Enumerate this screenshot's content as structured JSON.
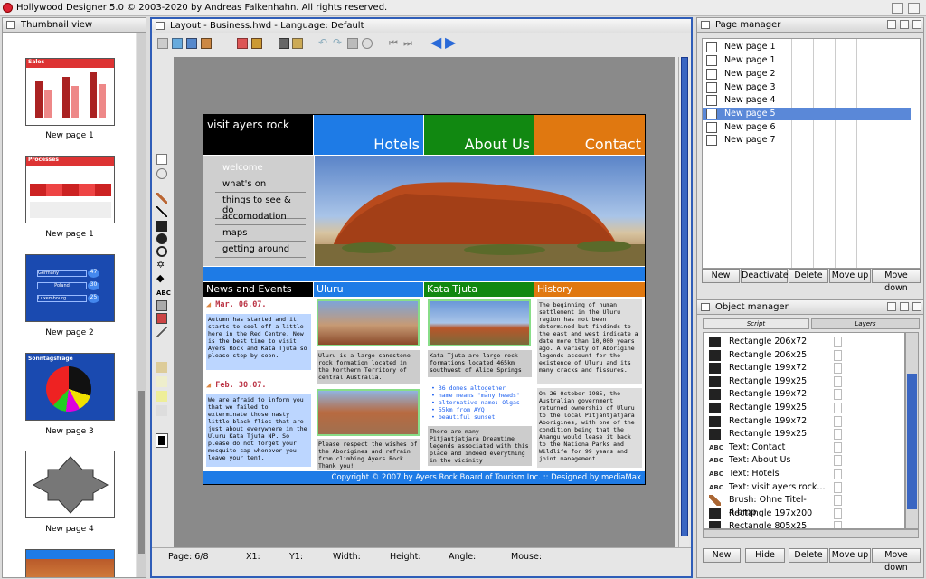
{
  "app": {
    "title": "Hollywood Designer 5.0 © 2003-2020 by Andreas Falkenhahn. All rights reserved."
  },
  "thumbnail_panel": {
    "title": "Thumbnail view",
    "thumbs": [
      {
        "label": "New page 1",
        "kind": "Sales"
      },
      {
        "label": "New page 1",
        "kind": "Processes"
      },
      {
        "label": "New page 2",
        "kind": "Countries",
        "rows": [
          {
            "name": "Germany",
            "value": "47"
          },
          {
            "name": "Poland",
            "value": "30"
          },
          {
            "name": "Luxembourg",
            "value": "25"
          }
        ]
      },
      {
        "label": "New page 3",
        "kind": "Sonntagsfrage"
      },
      {
        "label": "New page 4",
        "kind": "Shape"
      },
      {
        "label": "",
        "kind": "Ayers"
      }
    ],
    "thumb_titles": {
      "sales": "Sales",
      "processes": "Processes",
      "sonntag": "Sonntagsfrage"
    }
  },
  "layout": {
    "title": "Layout - Business.hwd - Language: Default"
  },
  "statusbar": {
    "page": "Page:  6/8",
    "x1": "X1:",
    "y1": "Y1:",
    "width": "Width:",
    "height": "Height:",
    "angle": "Angle:",
    "mouse": "Mouse:"
  },
  "site": {
    "brand": "visit ayers rock",
    "nav": [
      {
        "label": "Hotels",
        "color": "#1e7be6"
      },
      {
        "label": "About Us",
        "color": "#118811"
      },
      {
        "label": "Contact",
        "color": "#e07810"
      }
    ],
    "menu": [
      "welcome",
      "what's on",
      "things to see & do",
      "accomodation",
      "maps",
      "getting around"
    ],
    "sections": {
      "news": "News and Events",
      "uluru": "Uluru",
      "kata": "Kata Tjuta",
      "history": "History"
    },
    "news": [
      {
        "date": "Mar. 06.07.",
        "text": "Autumn has started and it starts to cool off a little here in the Red Centre. Now is the best time to visit Ayers Rock and Kata Tjuta so please stop by soon."
      },
      {
        "date": "Feb. 30.07.",
        "text": "We are afraid to inform you that we failed to exterminate those nasty little black flies that are just about everywhere in the Uluru Kata Tjuta NP. So please do not forget your mosquito cap whenever you leave your tent."
      }
    ],
    "uluru_text1": "Uluru is a large sandstone rock formation located in the Northern Territory of central Australia.",
    "uluru_text2": "Please respect the wishes of the Aborigines and refrain from climbing Ayers Rock. Thank you!",
    "kata_text1": "Kata Tjuta are large rock formations located 465km southwest of Alice Springs",
    "kata_bullets": [
      "36 domes altogether",
      "name means \"many heads\"",
      "alternative name: Olgas",
      "55km from AYQ",
      "beautiful sunset"
    ],
    "kata_text2": "There are many Pitjantjatjara Dreamtime legends associated with this place and indeed everything in the vicinity",
    "history1": "The beginning of human settlement in the Uluru region has not been determined but findinds to the east and west indicate a date more than 10,000 years ago. A variety of Aborigine legends account for the existence of Uluru and its many cracks and fissures.",
    "history2": "On 26 October 1985, the Australian government returned ownership of Uluru to the local Pitjantjatjara Aborigines, with one of the condition being that the Anangu would lease it back to the Nationa Parks and Wildlife for 99 years and joint management.",
    "footer": "Copyright © 2007 by Ayers Rock Board of Tourism Inc. :: Designed by mediaMax"
  },
  "page_manager": {
    "title": "Page manager",
    "pages": [
      "New page 1",
      "New page 1",
      "New page 2",
      "New page 3",
      "New page 4",
      "New page 5",
      "New page 6",
      "New page 7"
    ],
    "selected_index": 5,
    "buttons": [
      "New",
      "Deactivate",
      "Delete",
      "Move up",
      "Move down"
    ]
  },
  "object_manager": {
    "title": "Object manager",
    "tabs": [
      "Script",
      "Layers"
    ],
    "objects": [
      {
        "name": "Rectangle 206x72",
        "type": "rect"
      },
      {
        "name": "Rectangle 206x25",
        "type": "rect"
      },
      {
        "name": "Rectangle 199x72",
        "type": "rect"
      },
      {
        "name": "Rectangle 199x25",
        "type": "rect"
      },
      {
        "name": "Rectangle 199x72",
        "type": "rect"
      },
      {
        "name": "Rectangle 199x25",
        "type": "rect"
      },
      {
        "name": "Rectangle 199x72",
        "type": "rect"
      },
      {
        "name": "Rectangle 199x25",
        "type": "rect"
      },
      {
        "name": "Text: Contact",
        "type": "text"
      },
      {
        "name": "Text: About Us",
        "type": "text"
      },
      {
        "name": "Text: Hotels",
        "type": "text"
      },
      {
        "name": "Text: visit ayers rock...",
        "type": "text"
      },
      {
        "name": "Brush: Ohne Titel-4.bmp",
        "type": "brush"
      },
      {
        "name": "Rectangle 197x200",
        "type": "rect"
      },
      {
        "name": "Rectangle 805x25",
        "type": "rect"
      }
    ],
    "buttons": [
      "New",
      "Hide",
      "Delete",
      "Move up",
      "Move down"
    ]
  }
}
